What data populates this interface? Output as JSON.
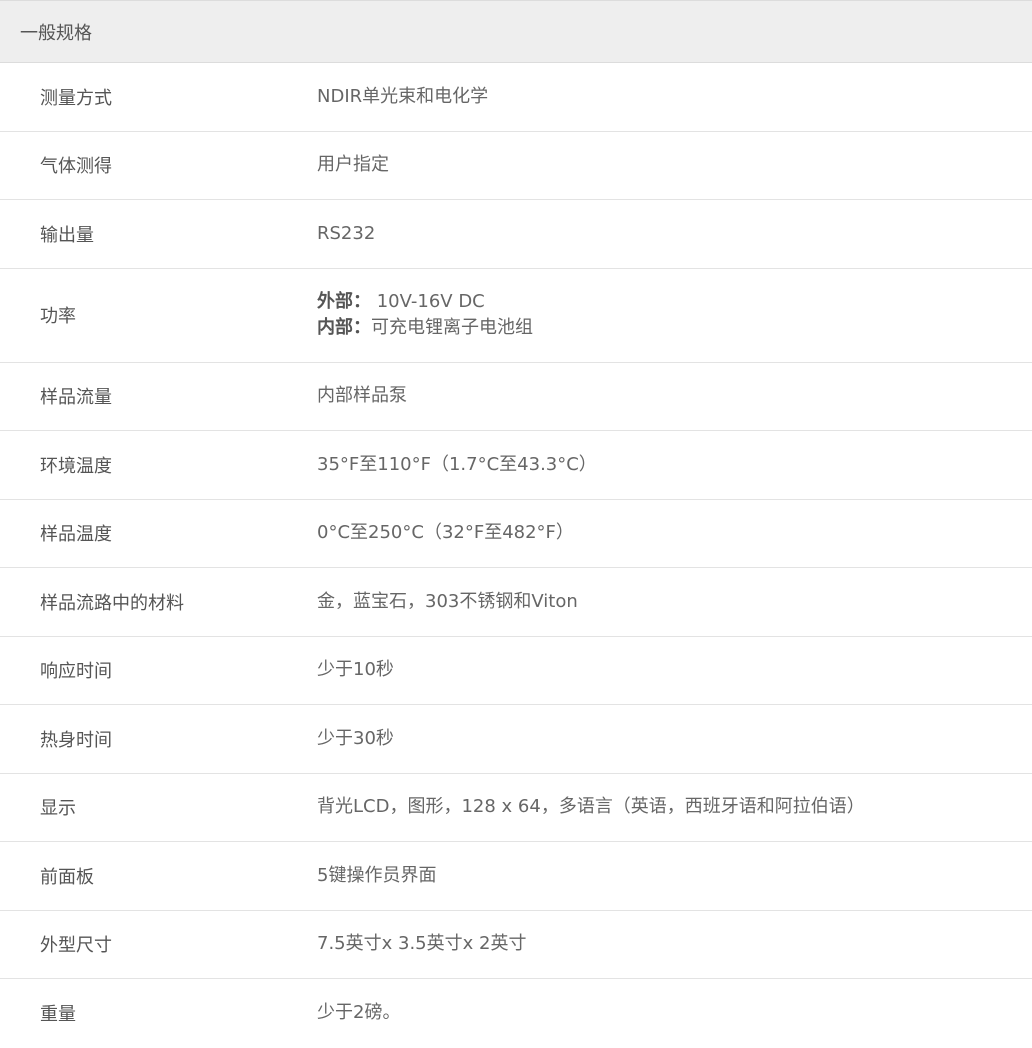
{
  "section": {
    "title": "一般规格"
  },
  "rows": [
    {
      "label": "测量方式",
      "value": "NDIR单光束和电化学"
    },
    {
      "label": "气体测得",
      "value": "用户指定"
    },
    {
      "label": "输出量",
      "value": "RS232"
    },
    {
      "label": "功率",
      "lines": [
        {
          "key": "外部：",
          "text": " 10V-16V DC"
        },
        {
          "key": "内部：",
          "text": "可充电锂离子电池组"
        }
      ]
    },
    {
      "label": "样品流量",
      "value": "内部样品泵"
    },
    {
      "label": "环境温度",
      "value": "35°F至110°F（1.7°C至43.3°C）"
    },
    {
      "label": "样品温度",
      "value": "0°C至250°C（32°F至482°F）"
    },
    {
      "label": "样品流路中的材料",
      "value": "金，蓝宝石，303不锈钢和Viton"
    },
    {
      "label": "响应时间",
      "value": "少于10秒"
    },
    {
      "label": "热身时间",
      "value": "少于30秒"
    },
    {
      "label": "显示",
      "value": "背光LCD，图形，128 x 64，多语言（英语，西班牙语和阿拉伯语）"
    },
    {
      "label": "前面板",
      "value": "5键操作员界面"
    },
    {
      "label": "外型尺寸",
      "value": "7.5英寸x 3.5英寸x 2英寸"
    },
    {
      "label": "重量",
      "value": "少于2磅。"
    }
  ]
}
